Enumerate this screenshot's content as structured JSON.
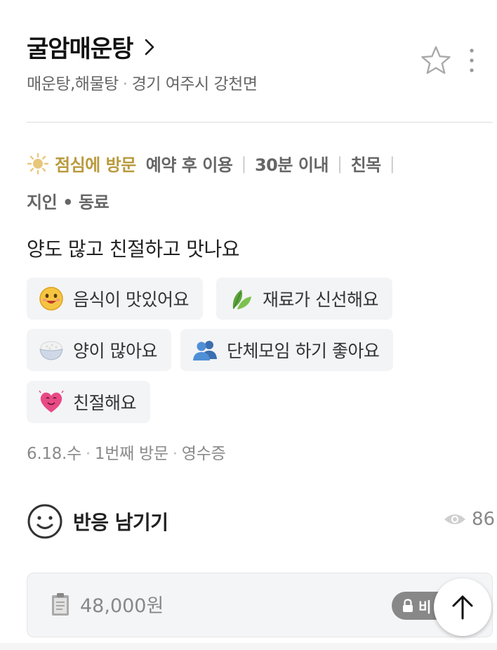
{
  "place": {
    "name": "굴암매운탕",
    "category": "매운탕,해물탕",
    "location": "경기 여주시 강천면",
    "separator": "·"
  },
  "visit": {
    "time": "점심에 방문",
    "options": [
      "예약 후 이용",
      "30분 이내",
      "친목"
    ],
    "companions": [
      "지인",
      "동료"
    ],
    "sep": "|",
    "mid": "•"
  },
  "review": {
    "text": "양도 많고 친절하고 맛나요",
    "tags": [
      {
        "label": "음식이 맛있어요",
        "icon": "smiley-face-icon"
      },
      {
        "label": "재료가 신선해요",
        "icon": "leaf-icon"
      },
      {
        "label": "양이 많아요",
        "icon": "rice-bowl-icon"
      },
      {
        "label": "단체모임 하기 좋아요",
        "icon": "group-people-icon"
      },
      {
        "label": "친절해요",
        "icon": "heart-face-icon"
      }
    ]
  },
  "meta": {
    "date": "6.18.수",
    "visit_count": "1번째 방문",
    "proof": "영수증",
    "separator": "·"
  },
  "reaction": {
    "label": "반응 남기기",
    "views": "86"
  },
  "price": {
    "amount": "48,000원",
    "lock_label": "비"
  },
  "colors": {
    "accent_gold": "#b99a3d",
    "text_gray": "#666666",
    "tag_bg": "#f3f4f6"
  }
}
